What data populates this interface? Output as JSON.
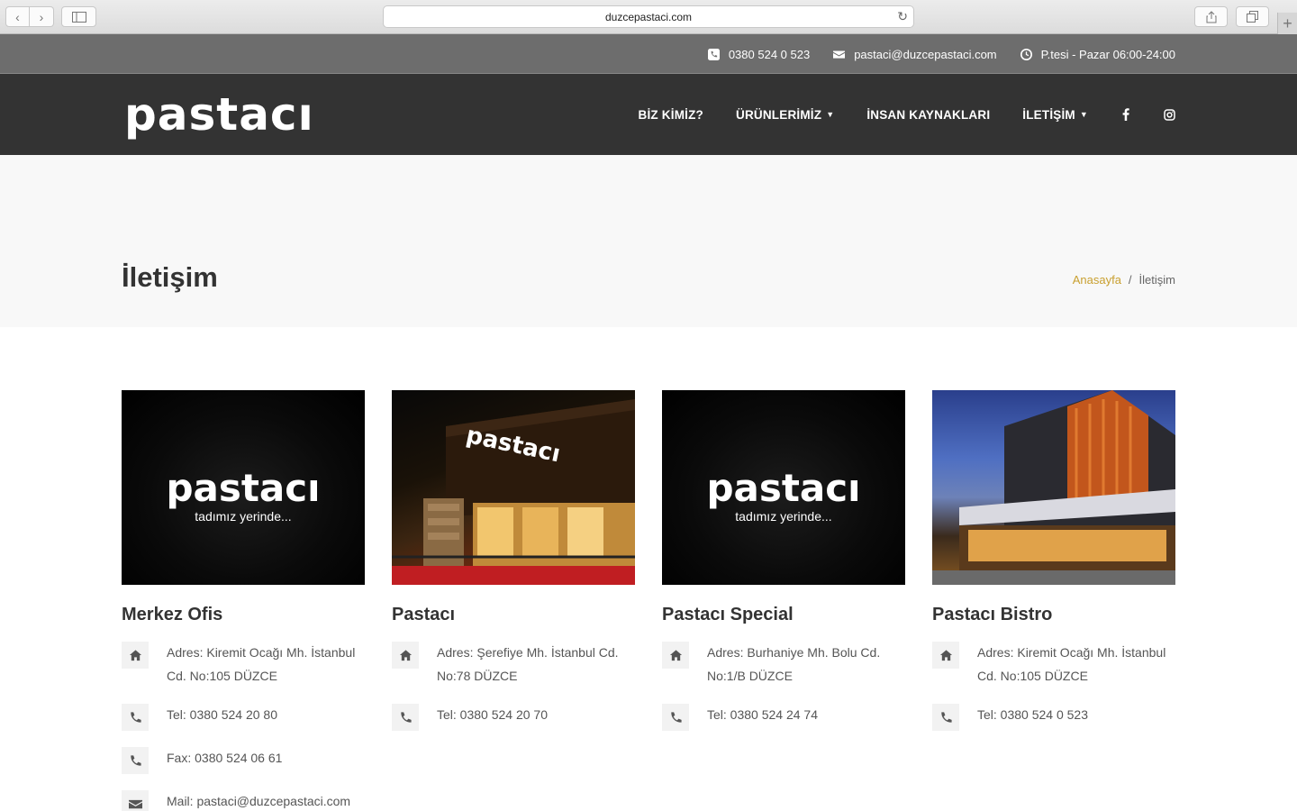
{
  "browser": {
    "url": "duzcepastaci.com"
  },
  "topbar": {
    "phone": "0380 524 0 523",
    "email": "pastaci@duzcepastaci.com",
    "hours": "P.tesi - Pazar 06:00-24:00"
  },
  "header": {
    "logo": "pastacı",
    "menu": [
      {
        "label": "BİZ KİMİZ?"
      },
      {
        "label": "ÜRÜNLERİMİZ"
      },
      {
        "label": "İNSAN KAYNAKLARI"
      },
      {
        "label": "İLETİŞİM"
      }
    ],
    "social": [
      "facebook-icon",
      "instagram-icon"
    ]
  },
  "page": {
    "title": "İletişim",
    "breadcrumb_home": "Anasayfa",
    "breadcrumb_sep": "/",
    "breadcrumb_current": "İletişim"
  },
  "cards": [
    {
      "image_logo": "pastacı",
      "image_tag": "tadımız yerinde...",
      "title": "Merkez Ofis",
      "address": "Adres: Kiremit Ocağı Mh. İstanbul Cd. No:105  DÜZCE",
      "tel": "Tel: 0380 524 20 80",
      "fax": "Fax: 0380 524 06 61",
      "mail": "Mail: pastaci@duzcepastaci.com"
    },
    {
      "title": "Pastacı",
      "address": "Adres: Şerefiye Mh. İstanbul Cd. No:78  DÜZCE",
      "tel": "Tel: 0380 524 20 70"
    },
    {
      "image_logo": "pastacı",
      "image_tag": "tadımız yerinde...",
      "title": "Pastacı Special",
      "address": "Adres: Burhaniye Mh. Bolu Cd. No:1/B  DÜZCE",
      "tel": "Tel: 0380 524 24 74"
    },
    {
      "title": "Pastacı Bistro",
      "address": "Adres: Kiremit Ocağı Mh. İstanbul Cd. No:105  DÜZCE",
      "tel": "Tel: 0380 524 0 523"
    }
  ],
  "colors": {
    "header": "#333333",
    "topbar": "#6d6d6d",
    "accent": "#c9a030"
  }
}
